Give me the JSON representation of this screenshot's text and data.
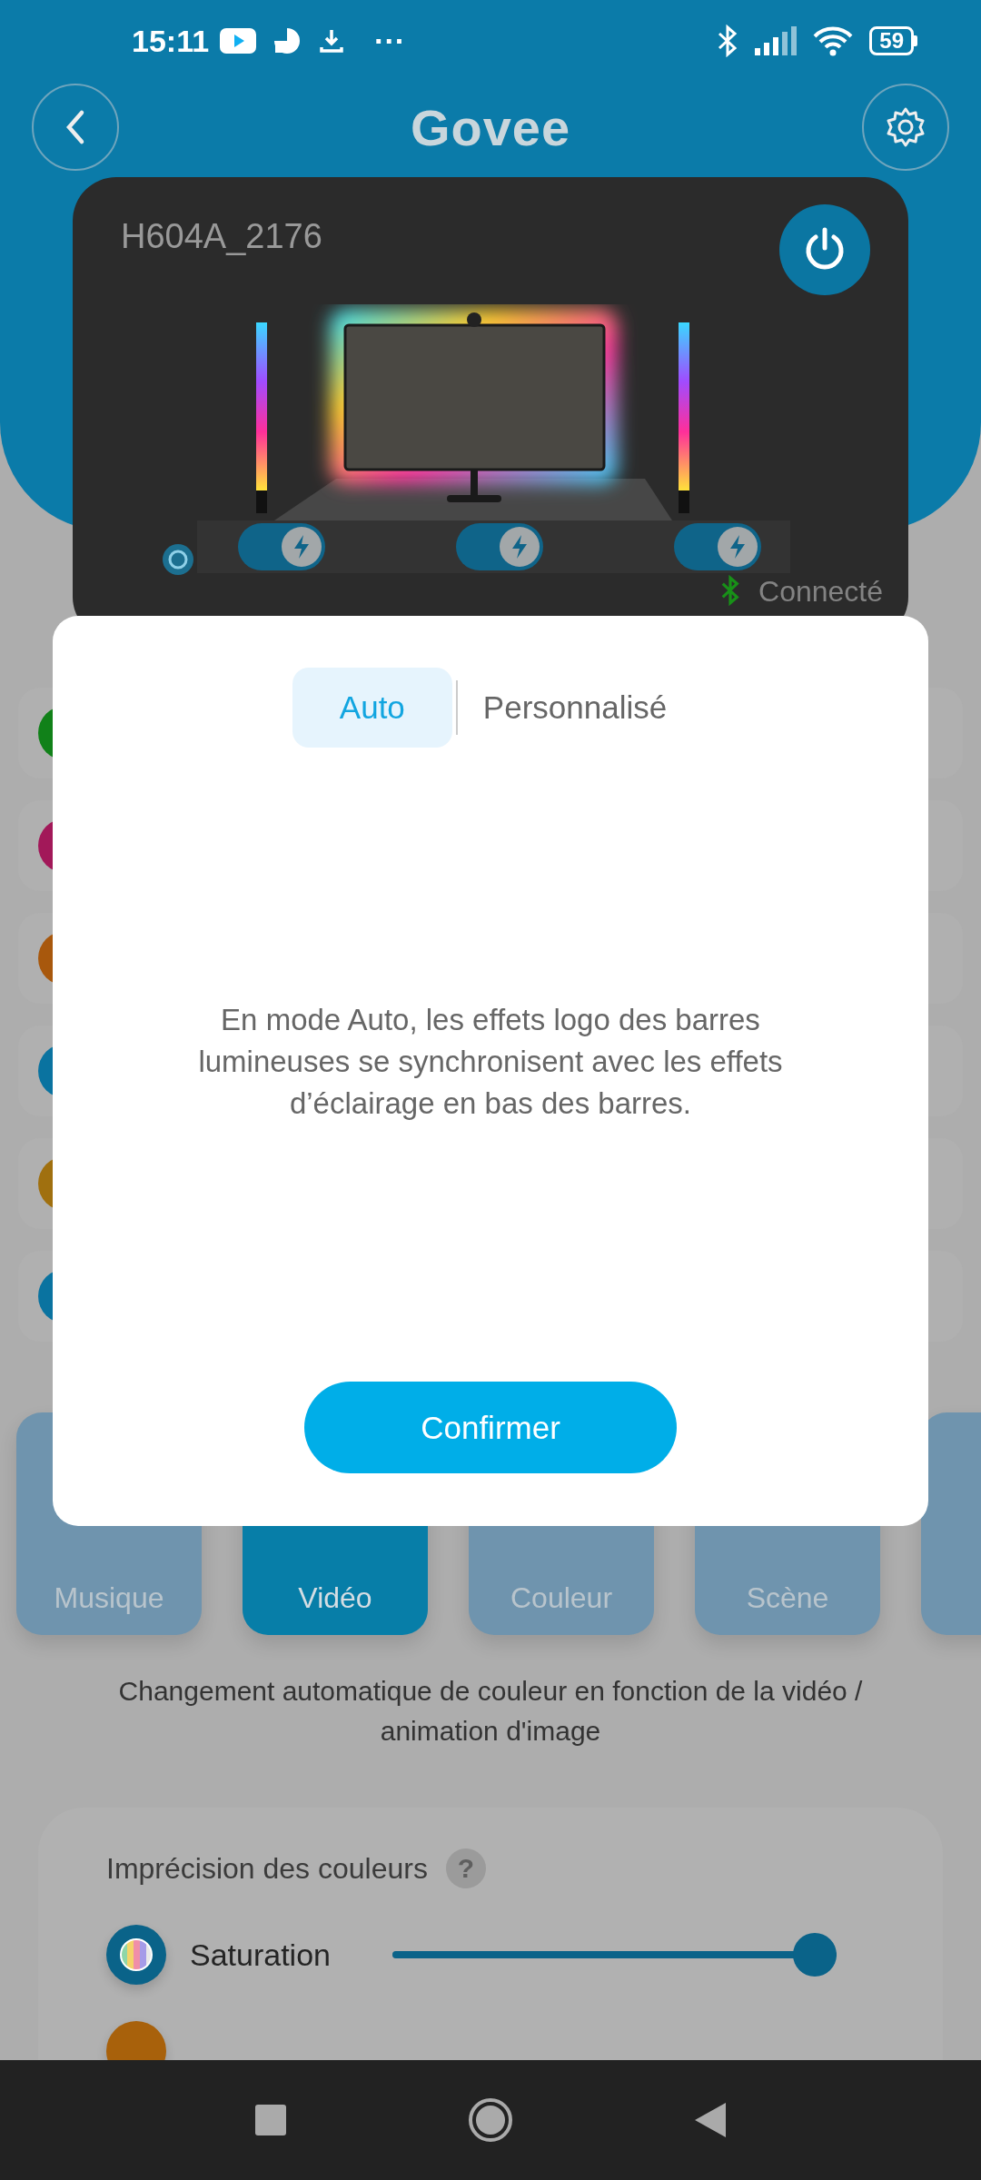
{
  "status_bar": {
    "time": "15:11",
    "more": "···",
    "battery": "59"
  },
  "header": {
    "logo": "Govee"
  },
  "device": {
    "name": "H604A_2176",
    "power_on": true,
    "connection": "Connecté",
    "toggles": [
      {
        "on": true
      },
      {
        "on": true
      },
      {
        "on": true
      }
    ]
  },
  "feature_rows": [
    {
      "color": "#118119"
    },
    {
      "color": "#a21859"
    },
    {
      "color": "#a8580d"
    },
    {
      "color": "#0a73a0"
    },
    {
      "color": "#a0700f"
    },
    {
      "color": "#0a73a0"
    }
  ],
  "modes": [
    {
      "label": "Musique",
      "selected": false
    },
    {
      "label": "Vidéo",
      "selected": true
    },
    {
      "label": "Couleur",
      "selected": false
    },
    {
      "label": "Scène",
      "selected": false
    },
    {
      "selected": false
    }
  ],
  "mode_description": "Changement automatique de couleur en fonction de la vidéo / animation d'image",
  "settings": {
    "title": "Imprécision des couleurs",
    "help": "?",
    "rows": [
      {
        "kind": "slider",
        "label": "Saturation",
        "color": "#0a6389",
        "level": 1
      },
      {
        "kind": "partial",
        "color": "#a8610b"
      }
    ]
  },
  "dialog": {
    "tabs": [
      {
        "label": "Auto",
        "selected": true
      },
      {
        "label": "Personnalisé",
        "selected": false
      }
    ],
    "message": "En mode Auto, les effets logo des barres lumineuses se synchronisent avec les effets d’éclairage en bas des barres.",
    "confirm": "Confirmer"
  }
}
